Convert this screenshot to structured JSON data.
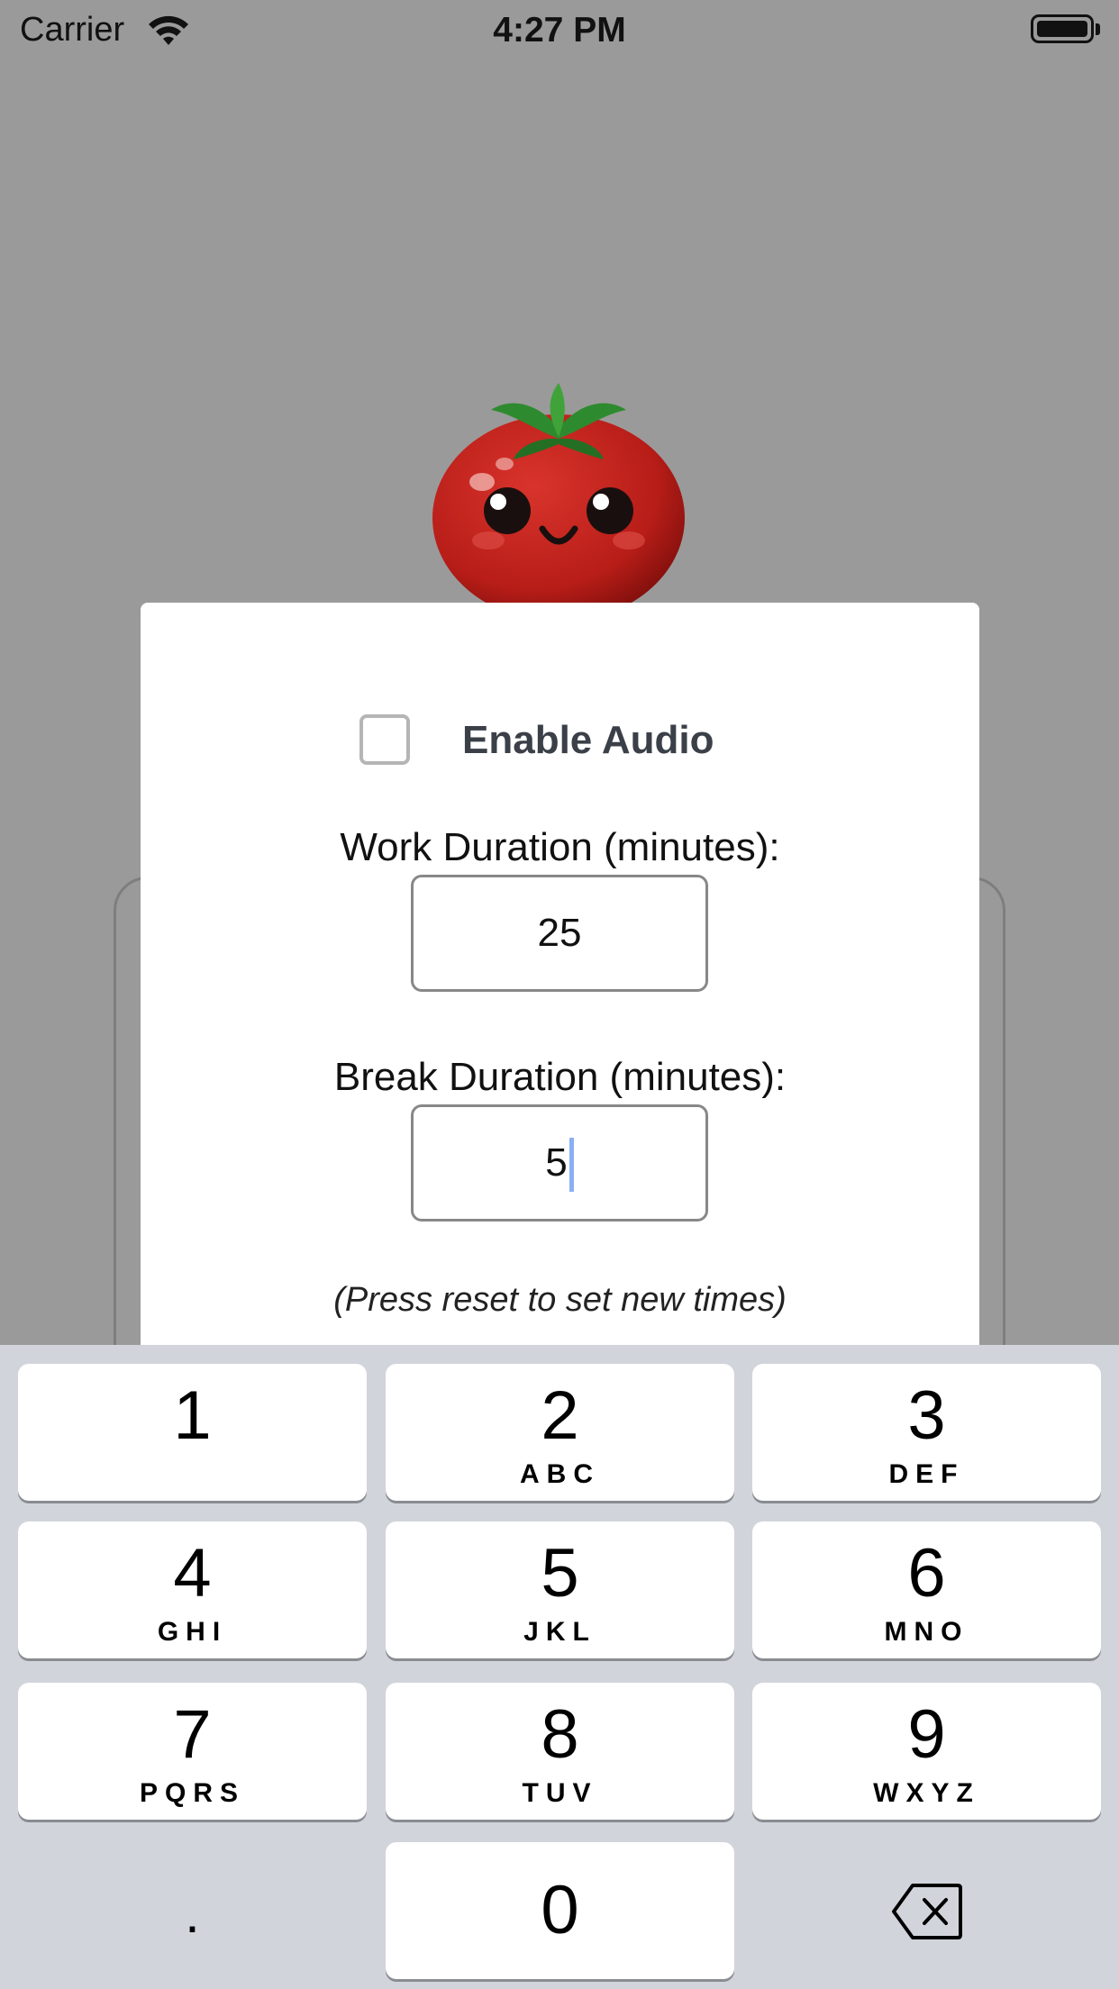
{
  "status_bar": {
    "carrier": "Carrier",
    "time": "4:27 PM"
  },
  "settings": {
    "audio_label": "Enable Audio",
    "audio_enabled": false,
    "work_label": "Work Duration (minutes):",
    "work_value": "25",
    "break_label": "Break Duration (minutes):",
    "break_value": "5",
    "hint": "(Press reset to set new times)"
  },
  "keyboard": {
    "keys": [
      {
        "digit": "1",
        "letters": ""
      },
      {
        "digit": "2",
        "letters": "ABC"
      },
      {
        "digit": "3",
        "letters": "DEF"
      },
      {
        "digit": "4",
        "letters": "GHI"
      },
      {
        "digit": "5",
        "letters": "JKL"
      },
      {
        "digit": "6",
        "letters": "MNO"
      },
      {
        "digit": "7",
        "letters": "PQRS"
      },
      {
        "digit": "8",
        "letters": "TUV"
      },
      {
        "digit": "9",
        "letters": "WXYZ"
      }
    ],
    "dot": ".",
    "zero": "0",
    "delete_icon": "backspace-icon"
  },
  "colors": {
    "backdrop": "#9a9a9a",
    "tomato": "#c0221c",
    "leaf": "#2e8a2e",
    "keyboard_bg": "#d1d4da"
  }
}
